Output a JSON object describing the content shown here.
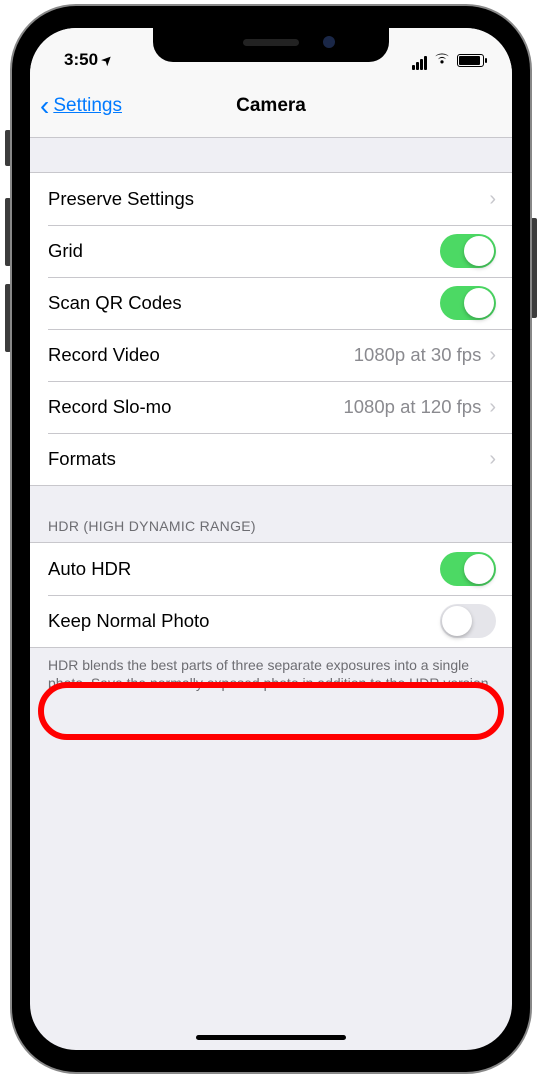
{
  "statusbar": {
    "time": "3:50"
  },
  "nav": {
    "back": "Settings",
    "title": "Camera"
  },
  "section1": {
    "rows": [
      {
        "label": "Preserve Settings",
        "detail": ""
      },
      {
        "label": "Grid"
      },
      {
        "label": "Scan QR Codes"
      },
      {
        "label": "Record Video",
        "detail": "1080p at 30 fps"
      },
      {
        "label": "Record Slo-mo",
        "detail": "1080p at 120 fps"
      },
      {
        "label": "Formats",
        "detail": ""
      }
    ]
  },
  "section2": {
    "header": "HDR (HIGH DYNAMIC RANGE)",
    "rows": [
      {
        "label": "Auto HDR"
      },
      {
        "label": "Keep Normal Photo"
      }
    ],
    "footer": "HDR blends the best parts of three separate exposures into a single photo. Save the normally exposed photo in addition to the HDR version."
  }
}
